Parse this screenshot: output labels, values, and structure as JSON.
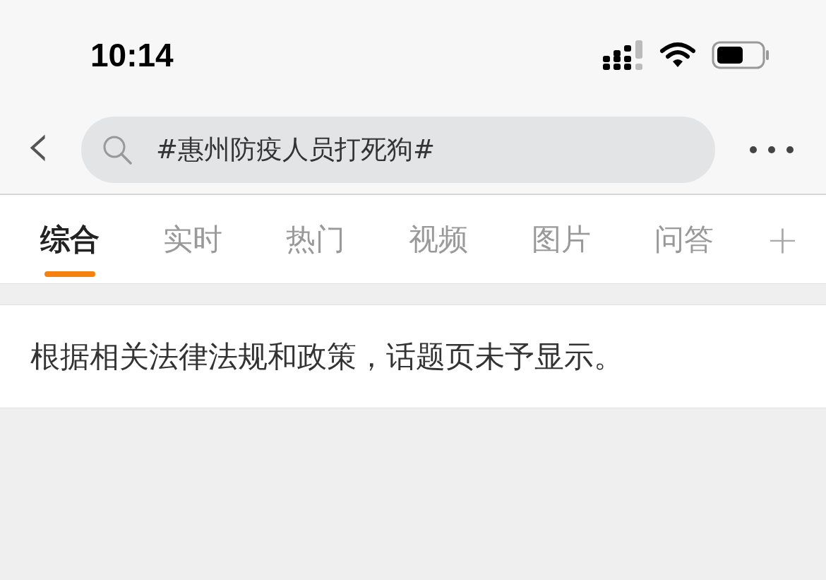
{
  "status_bar": {
    "time": "10:14"
  },
  "nav_bar": {
    "back": "‹",
    "search": {
      "value": "#惠州防疫人员打死狗#"
    }
  },
  "tabs": [
    {
      "label": "综合",
      "selected": true
    },
    {
      "label": "实时",
      "selected": false
    },
    {
      "label": "热门",
      "selected": false
    },
    {
      "label": "视频",
      "selected": false
    },
    {
      "label": "图片",
      "selected": false
    },
    {
      "label": "问答",
      "selected": false
    }
  ],
  "add_tab": "+",
  "notice": "根据相关法律法规和政策，话题页未予显示。"
}
